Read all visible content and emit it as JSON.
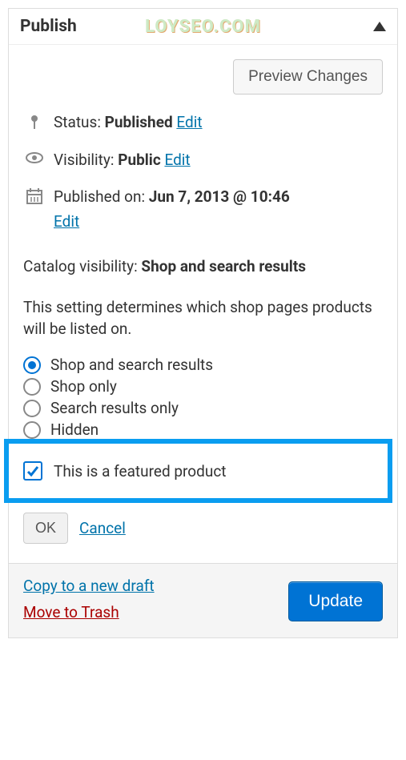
{
  "header": {
    "title": "Publish",
    "watermark": "LOYSEO.COM"
  },
  "preview_button": "Preview Changes",
  "status": {
    "label": "Status:",
    "value": "Published",
    "edit": "Edit"
  },
  "visibility": {
    "label": "Visibility:",
    "value": "Public",
    "edit": "Edit"
  },
  "published": {
    "label": "Published on:",
    "value": "Jun 7, 2013 @ 10:46",
    "edit": "Edit"
  },
  "catalog": {
    "label": "Catalog visibility:",
    "value": "Shop and search results"
  },
  "description": "This setting determines which shop pages products will be listed on.",
  "radios": [
    {
      "label": "Shop and search results",
      "checked": true
    },
    {
      "label": "Shop only",
      "checked": false
    },
    {
      "label": "Search results only",
      "checked": false
    },
    {
      "label": "Hidden",
      "checked": false
    }
  ],
  "featured": {
    "label": "This is a featured product",
    "checked": true
  },
  "ok": "OK",
  "cancel": "Cancel",
  "footer": {
    "copy": "Copy to a new draft",
    "trash": "Move to Trash",
    "update": "Update"
  }
}
